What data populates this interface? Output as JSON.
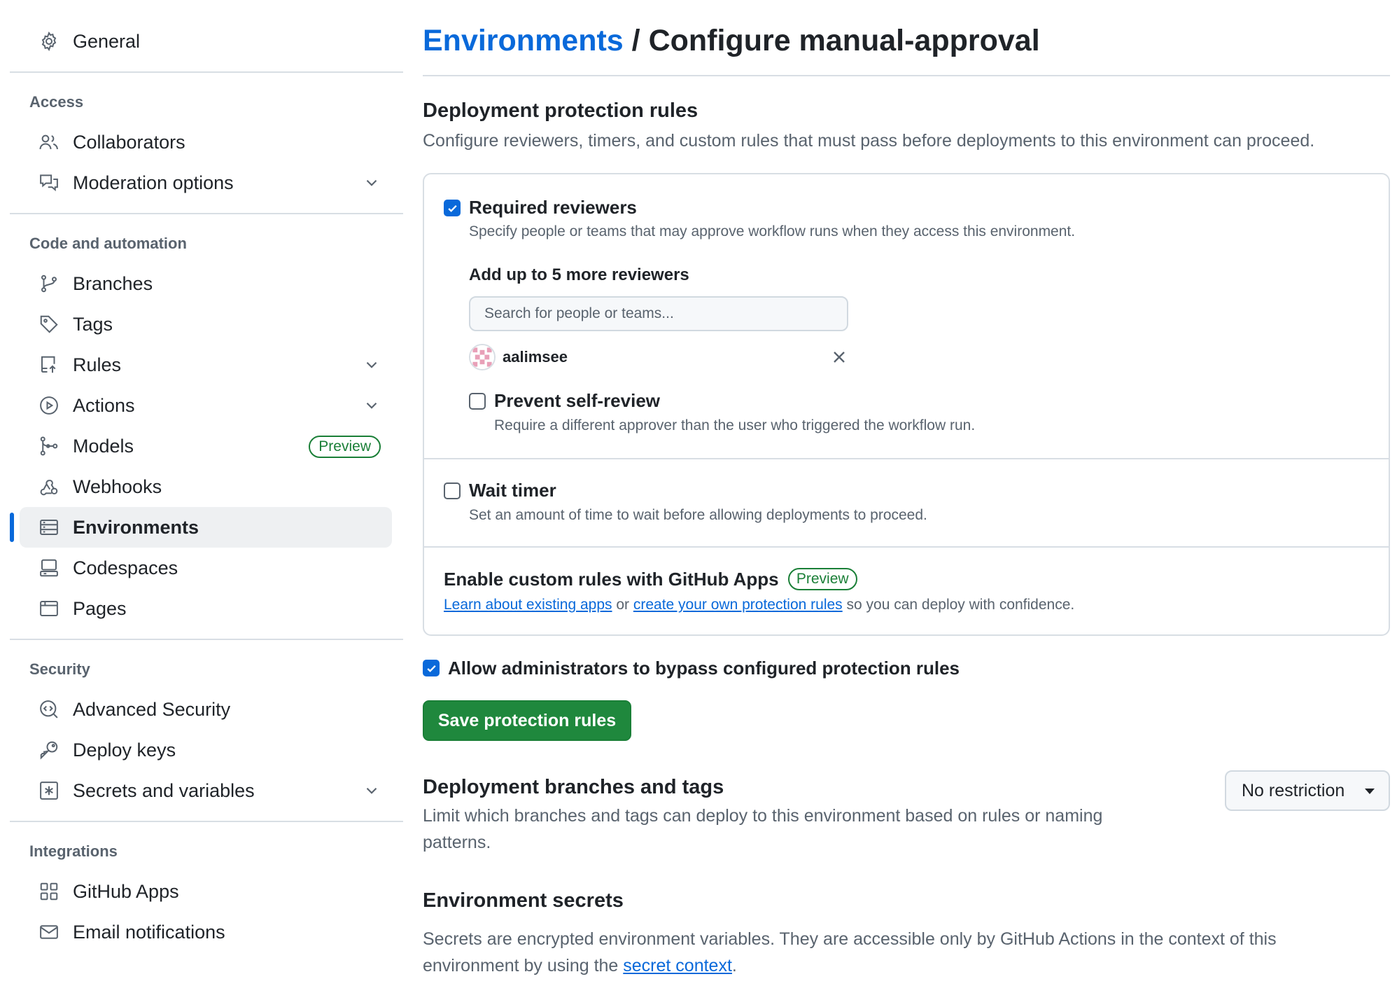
{
  "sidebar": {
    "general": "General",
    "sections": {
      "access": "Access",
      "code": "Code and automation",
      "security": "Security",
      "integrations": "Integrations"
    },
    "items": {
      "collaborators": "Collaborators",
      "moderation": "Moderation options",
      "branches": "Branches",
      "tags": "Tags",
      "rules": "Rules",
      "actions": "Actions",
      "models": "Models",
      "models_badge": "Preview",
      "webhooks": "Webhooks",
      "environments": "Environments",
      "codespaces": "Codespaces",
      "pages": "Pages",
      "advanced_security": "Advanced Security",
      "deploy_keys": "Deploy keys",
      "secrets": "Secrets and variables",
      "github_apps": "GitHub Apps",
      "email_notifications": "Email notifications"
    }
  },
  "header": {
    "breadcrumb_link": "Environments",
    "separator": " / ",
    "title": "Configure manual-approval"
  },
  "protection": {
    "heading": "Deployment protection rules",
    "description": "Configure reviewers, timers, and custom rules that must pass before deployments to this environment can proceed.",
    "required_reviewers": {
      "checked": true,
      "label": "Required reviewers",
      "description": "Specify people or teams that may approve workflow runs when they access this environment.",
      "add_label": "Add up to 5 more reviewers",
      "search_placeholder": "Search for people or teams...",
      "reviewer": "aalimsee",
      "prevent_self_review": {
        "checked": false,
        "label": "Prevent self-review",
        "description": "Require a different approver than the user who triggered the workflow run."
      }
    },
    "wait_timer": {
      "checked": false,
      "label": "Wait timer",
      "description": "Set an amount of time to wait before allowing deployments to proceed."
    },
    "custom_rules": {
      "label": "Enable custom rules with GitHub Apps",
      "badge": "Preview",
      "link1": "Learn about existing apps",
      "or": " or ",
      "link2": "create your own protection rules",
      "suffix": " so you can deploy with confidence."
    },
    "admin_bypass": {
      "checked": true,
      "label": "Allow administrators to bypass configured protection rules"
    },
    "save_button": "Save protection rules"
  },
  "branches": {
    "heading": "Deployment branches and tags",
    "description": "Limit which branches and tags can deploy to this environment based on rules or naming patterns.",
    "dropdown_value": "No restriction"
  },
  "secrets": {
    "heading": "Environment secrets",
    "description_prefix": "Secrets are encrypted environment variables. They are accessible only by GitHub Actions in the context of this environment by using the ",
    "link": "secret context",
    "description_suffix": "."
  },
  "colors": {
    "accent": "#0969da",
    "success": "#1f883d",
    "muted": "#59636e",
    "border": "#d8dee4"
  }
}
